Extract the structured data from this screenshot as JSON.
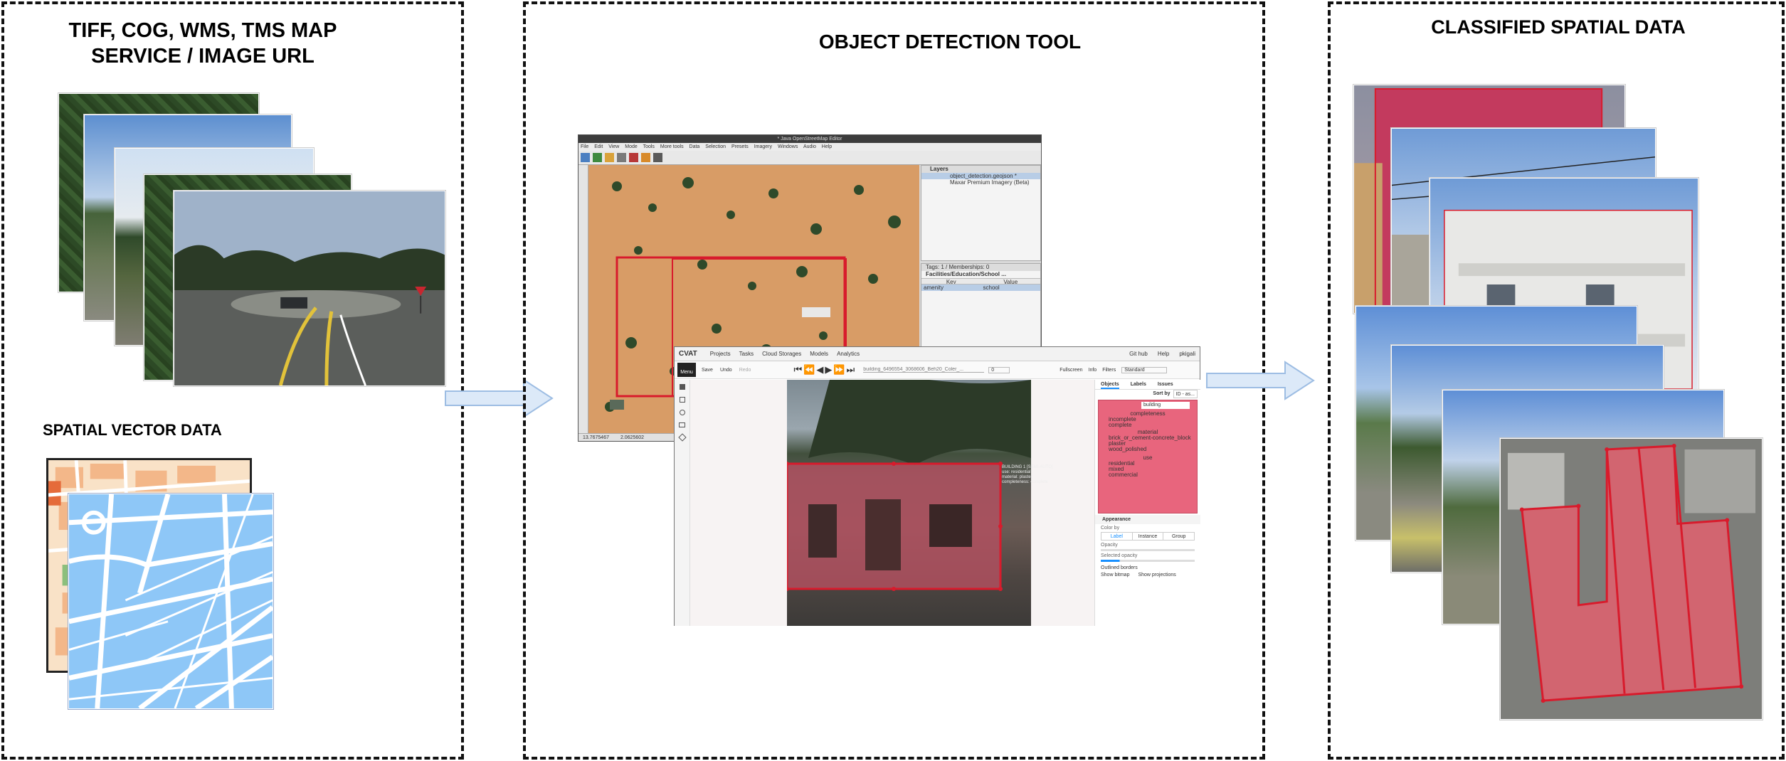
{
  "panels": {
    "left": {
      "title_line1": "TIFF, COG, WMS, TMS MAP",
      "title_line2": "SERVICE / IMAGE URL",
      "vector_title": "SPATIAL VECTOR DATA"
    },
    "middle": {
      "title": "OBJECT DETECTION TOOL"
    },
    "right": {
      "title": "CLASSIFIED SPATIAL DATA"
    }
  },
  "josm": {
    "window_title": "* Java OpenStreetMap Editor",
    "menu": [
      "File",
      "Edit",
      "View",
      "Mode",
      "Tools",
      "More tools",
      "Data",
      "Selection",
      "Presets",
      "Imagery",
      "Windows",
      "Audio",
      "Help"
    ],
    "layers_header": "Layers",
    "layers": [
      "object_detection.geojson *",
      "Maxar Premium Imagery (Beta)"
    ],
    "tags_header": "Tags: 1 / Memberships: 0",
    "preset_name": "Facilities/Education/School ...",
    "table_headers": [
      "Key",
      "Value"
    ],
    "table_row": [
      "amenity",
      "school"
    ],
    "status_coords": [
      "13.7675467",
      "2.0625602"
    ]
  },
  "cvat": {
    "logo": "CVAT",
    "nav": [
      "Projects",
      "Tasks",
      "Cloud Storages",
      "Models",
      "Analytics"
    ],
    "right_links": [
      "Git hub",
      "Help",
      "pkigali"
    ],
    "tool_labels": [
      "Menu",
      "Save",
      "Undo",
      "Redo"
    ],
    "file_name": "building_6496554_3068606_Beh20_Coler_...",
    "frame": "0",
    "right_controls": [
      "Fullscreen",
      "Info",
      "Filters"
    ],
    "workspace": "Standard",
    "sidebar_tabs": [
      "Objects",
      "Labels",
      "Issues"
    ],
    "sort_by_label": "Sort by",
    "sort_by_value": "ID - as...",
    "object_label": "building",
    "attr_groups": [
      {
        "name": "completeness",
        "options": [
          "incomplete",
          "complete"
        ]
      },
      {
        "name": "material",
        "options": [
          "brick_or_cement-concrete_block",
          "plaster",
          "wood_polished"
        ]
      },
      {
        "name": "use",
        "options": [
          "residential",
          "mixed",
          "commercial"
        ]
      }
    ],
    "appearance_header": "Appearance",
    "color_by_label": "Color by",
    "color_by": [
      "Label",
      "Instance",
      "Group"
    ],
    "opacity_label": "Opacity",
    "selected_opacity_label": "Selected opacity",
    "outlined_label": "Outlined borders",
    "show_bitmap": "Show bitmap",
    "show_projections": "Show projections",
    "overlay_text": [
      "BUILDING 1 [SEMI-AUTO]",
      "use: residential",
      "material: plaster",
      "completeness: complete"
    ]
  },
  "colors": {
    "arrow_fill": "#dce9f8",
    "arrow_stroke": "#9dbde3",
    "annotation_red": "#d81b2c",
    "cvat_label_pink": "#e8657d",
    "vector_blue": "#8ec7f7"
  }
}
